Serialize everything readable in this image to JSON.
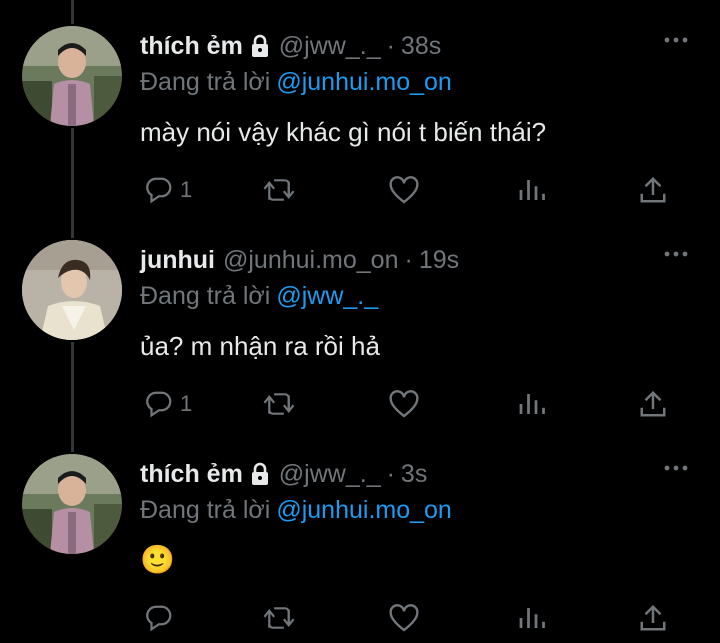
{
  "tweets": [
    {
      "name": "thích ẻm",
      "protected": true,
      "handle": "@jww_._",
      "separator": "·",
      "time": "38s",
      "reply_prefix": "Đang trả lời",
      "reply_to": "@junhui.mo_on",
      "text": "mày nói vậy khác gì nói t biến thái?",
      "reply_count": "1",
      "avatar": "boy-avatar"
    },
    {
      "name": "junhui",
      "protected": false,
      "handle": "@junhui.mo_on",
      "separator": "·",
      "time": "19s",
      "reply_prefix": "Đang trả lời",
      "reply_to": "@jww_._",
      "text": "ủa? m nhận ra rồi hả",
      "reply_count": "1",
      "avatar": "junhui-avatar"
    },
    {
      "name": "thích ẻm",
      "protected": true,
      "handle": "@jww_._",
      "separator": "·",
      "time": "3s",
      "reply_prefix": "Đang trả lời",
      "reply_to": "@junhui.mo_on",
      "text": "🙂",
      "reply_count": "",
      "avatar": "boy-avatar"
    }
  ],
  "icons": [
    "lock-icon",
    "more-icon",
    "reply-icon",
    "retweet-icon",
    "like-icon",
    "analytics-icon",
    "share-icon"
  ],
  "colors": {
    "background": "#000000",
    "text": "#e7e9ea",
    "muted": "#71767b",
    "link": "#1d9bf0",
    "thread_line": "#333639"
  }
}
